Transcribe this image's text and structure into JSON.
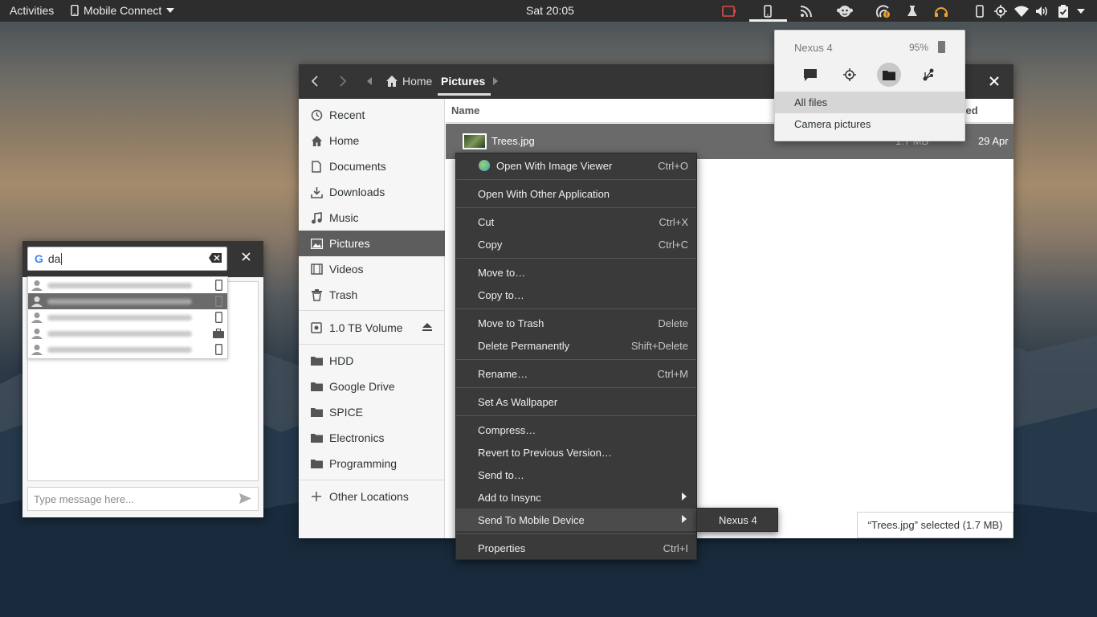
{
  "topbar": {
    "activities": "Activities",
    "app_menu": "Mobile Connect",
    "clock": "Sat 20:05"
  },
  "file_manager": {
    "breadcrumbs": [
      "Home",
      "Pictures"
    ],
    "sidebar": {
      "places": [
        "Recent",
        "Home",
        "Documents",
        "Downloads",
        "Music",
        "Pictures",
        "Videos",
        "Trash"
      ],
      "volume": "1.0 TB Volume",
      "bookmarks": [
        "HDD",
        "Google Drive",
        "SPICE",
        "Electronics",
        "Programming"
      ],
      "other": "Other Locations",
      "selected": "Pictures"
    },
    "columns": {
      "name": "Name",
      "modified": "dified"
    },
    "file": {
      "name": "Trees.jpg",
      "size": "1.7 MB",
      "date": "29 Apr"
    },
    "status": "“Trees.jpg” selected  (1.7 MB)"
  },
  "context_menu": {
    "items": [
      {
        "label": "Open With Image Viewer",
        "accel": "Ctrl+O"
      },
      {
        "label": "Open With Other Application",
        "accel": ""
      },
      {
        "label": "Cut",
        "accel": "Ctrl+X"
      },
      {
        "label": "Copy",
        "accel": "Ctrl+C"
      },
      {
        "label": "Move to…",
        "accel": ""
      },
      {
        "label": "Copy to…",
        "accel": ""
      },
      {
        "label": "Move to Trash",
        "accel": "Delete"
      },
      {
        "label": "Delete Permanently",
        "accel": "Shift+Delete"
      },
      {
        "label": "Rename…",
        "accel": "Ctrl+M"
      },
      {
        "label": "Set As Wallpaper",
        "accel": ""
      },
      {
        "label": "Compress…",
        "accel": ""
      },
      {
        "label": "Revert to Previous Version…",
        "accel": ""
      },
      {
        "label": "Send to…",
        "accel": ""
      },
      {
        "label": "Add to Insync",
        "accel": ""
      },
      {
        "label": "Send To Mobile Device",
        "accel": ""
      },
      {
        "label": "Properties",
        "accel": "Ctrl+I"
      }
    ],
    "submenu_item": "Nexus 4"
  },
  "popover": {
    "device": "Nexus 4",
    "battery": "95%",
    "menu": [
      "All files",
      "Camera pictures"
    ]
  },
  "sms": {
    "search_value": "da",
    "input_placeholder": "Type message here..."
  },
  "colors": {
    "topbar": "#2d2d2d",
    "menu_bg": "#3a3a3a",
    "selection": "#5d5d5d",
    "tray_red": "#e04a4a",
    "tray_orange": "#f0a22e"
  }
}
